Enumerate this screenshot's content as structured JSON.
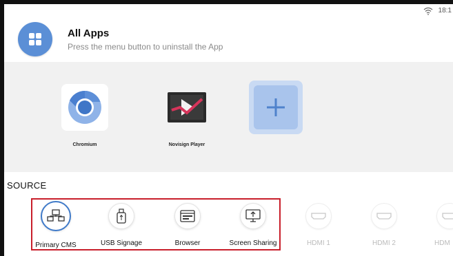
{
  "status_bar": {
    "time": "18:1",
    "wifi_icon": "wifi-icon"
  },
  "header": {
    "icon": "apps-grid-icon",
    "title": "All Apps",
    "subtitle": "Press the menu button to uninstall the App"
  },
  "apps": [
    {
      "label": "Chromium",
      "icon": "chromium-icon"
    },
    {
      "label": "Novisign Player",
      "icon": "novisign-player-icon"
    },
    {
      "label": "",
      "icon": "add-icon"
    }
  ],
  "source": {
    "title": "SOURCE",
    "items": [
      {
        "label": "Primary CMS",
        "icon": "network-cms-icon",
        "selected": true,
        "enabled": true
      },
      {
        "label": "USB Signage",
        "icon": "usb-icon",
        "selected": false,
        "enabled": true
      },
      {
        "label": "Browser",
        "icon": "browser-icon",
        "selected": false,
        "enabled": true
      },
      {
        "label": "Screen Sharing",
        "icon": "screen-share-icon",
        "selected": false,
        "enabled": true
      },
      {
        "label": "HDMI 1",
        "icon": "hdmi-icon",
        "selected": false,
        "enabled": false
      },
      {
        "label": "HDMI 2",
        "icon": "hdmi-icon",
        "selected": false,
        "enabled": false
      },
      {
        "label": "HDM",
        "icon": "hdmi-icon",
        "selected": false,
        "enabled": false
      }
    ]
  },
  "colors": {
    "accent": "#5b8fd6",
    "highlight": "#c81e2a",
    "panel_bg": "#f1f1f1",
    "add_tile": "#a9c4ec"
  }
}
